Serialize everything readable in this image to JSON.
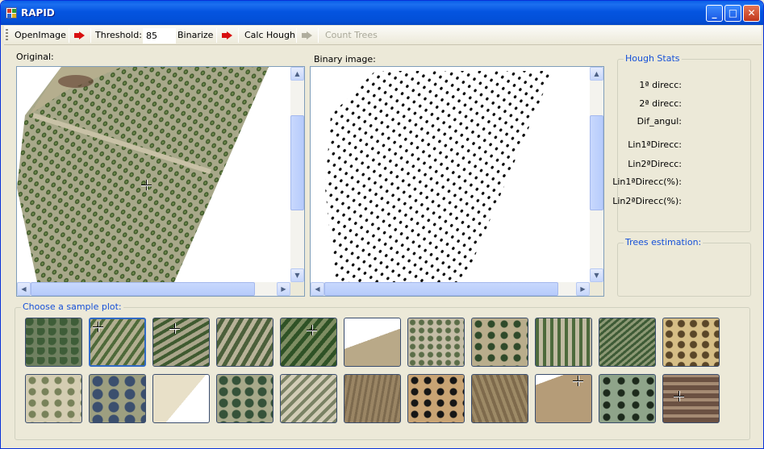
{
  "window": {
    "title": "RAPID",
    "buttons": {
      "minimize": "_",
      "maximize": "□",
      "close": "✕"
    }
  },
  "toolbar": {
    "open_label": "OpenImage",
    "threshold_label": "Threshold:",
    "threshold_value": "85",
    "binarize_label": "Binarize",
    "hough_label": "Calc Hough",
    "count_label": "Count Trees"
  },
  "panels": {
    "original_label": "Original:",
    "binary_label": "Binary image:"
  },
  "hough_stats": {
    "title": "Hough Stats",
    "items": [
      "1ª direcc:",
      "2ª direcc:",
      "Dif_angul:",
      "Lin1ªDirecc:",
      "Lin2ªDirecc:",
      "Lin1ªDirecc(%):",
      "Lin2ªDirecc(%):"
    ]
  },
  "trees": {
    "title": "Trees estimation:"
  },
  "samples": {
    "title": "Choose a sample plot:"
  },
  "icons": [
    "app-icon",
    "arrow-right-icon",
    "scroll-up-icon",
    "scroll-down-icon",
    "scroll-left-icon",
    "scroll-right-icon",
    "crosshair-cursor-icon"
  ],
  "colors": {
    "title_bar": "#0a5fe8",
    "group_title": "#1550d8",
    "arrow_active": "#d81010",
    "window_bg": "#ece9d8"
  }
}
